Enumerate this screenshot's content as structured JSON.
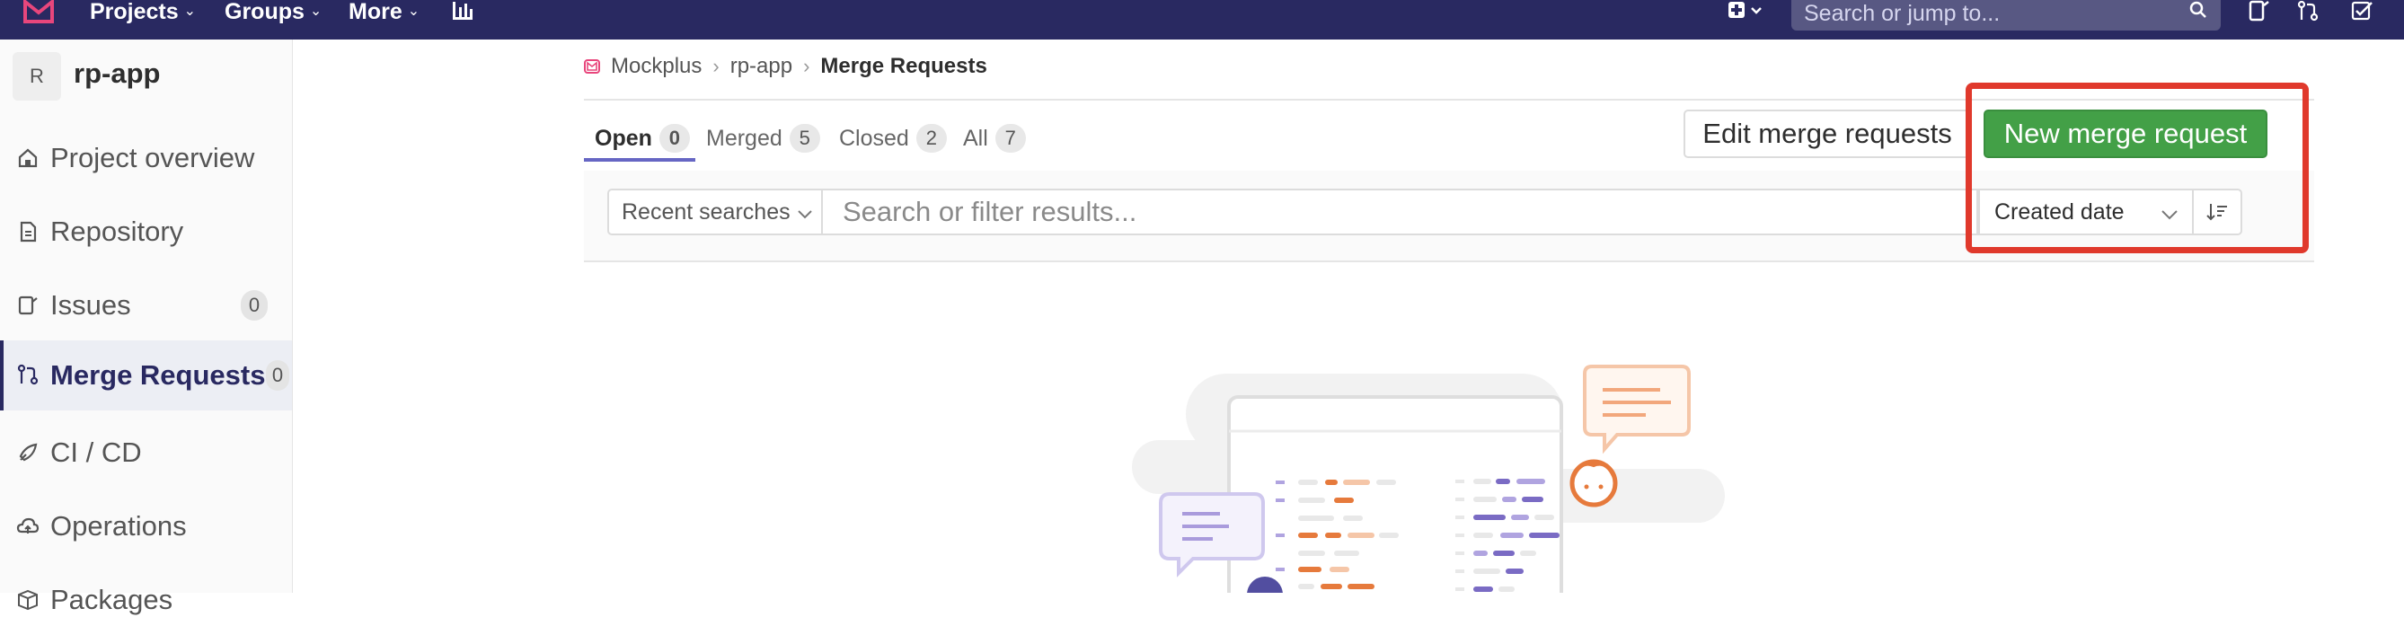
{
  "topbar": {
    "nav": [
      {
        "label": "Projects"
      },
      {
        "label": "Groups"
      },
      {
        "label": "More"
      }
    ],
    "search_placeholder": "Search or jump to...",
    "colors": {
      "bg": "#292961",
      "accent": "#e24329"
    }
  },
  "sidebar": {
    "project_initial": "R",
    "project_name": "rp-app",
    "items": [
      {
        "label": "Project overview",
        "icon": "home-icon"
      },
      {
        "label": "Repository",
        "icon": "doc-icon"
      },
      {
        "label": "Issues",
        "icon": "issues-icon",
        "count": "0"
      },
      {
        "label": "Merge Requests",
        "icon": "merge-request-icon",
        "count": "0",
        "active": true
      },
      {
        "label": "CI / CD",
        "icon": "rocket-icon"
      },
      {
        "label": "Operations",
        "icon": "cloud-icon"
      },
      {
        "label": "Packages",
        "icon": "package-icon"
      }
    ]
  },
  "breadcrumb": {
    "items": [
      "Mockplus",
      "rp-app",
      "Merge Requests"
    ]
  },
  "tabs": [
    {
      "label": "Open",
      "count": "0",
      "active": true
    },
    {
      "label": "Merged",
      "count": "5"
    },
    {
      "label": "Closed",
      "count": "2"
    },
    {
      "label": "All",
      "count": "7"
    }
  ],
  "actions": {
    "edit_label": "Edit merge requests",
    "new_label": "New merge request"
  },
  "filter": {
    "recent_label": "Recent searches",
    "search_placeholder": "Search or filter results...",
    "sort_label": "Created date"
  }
}
